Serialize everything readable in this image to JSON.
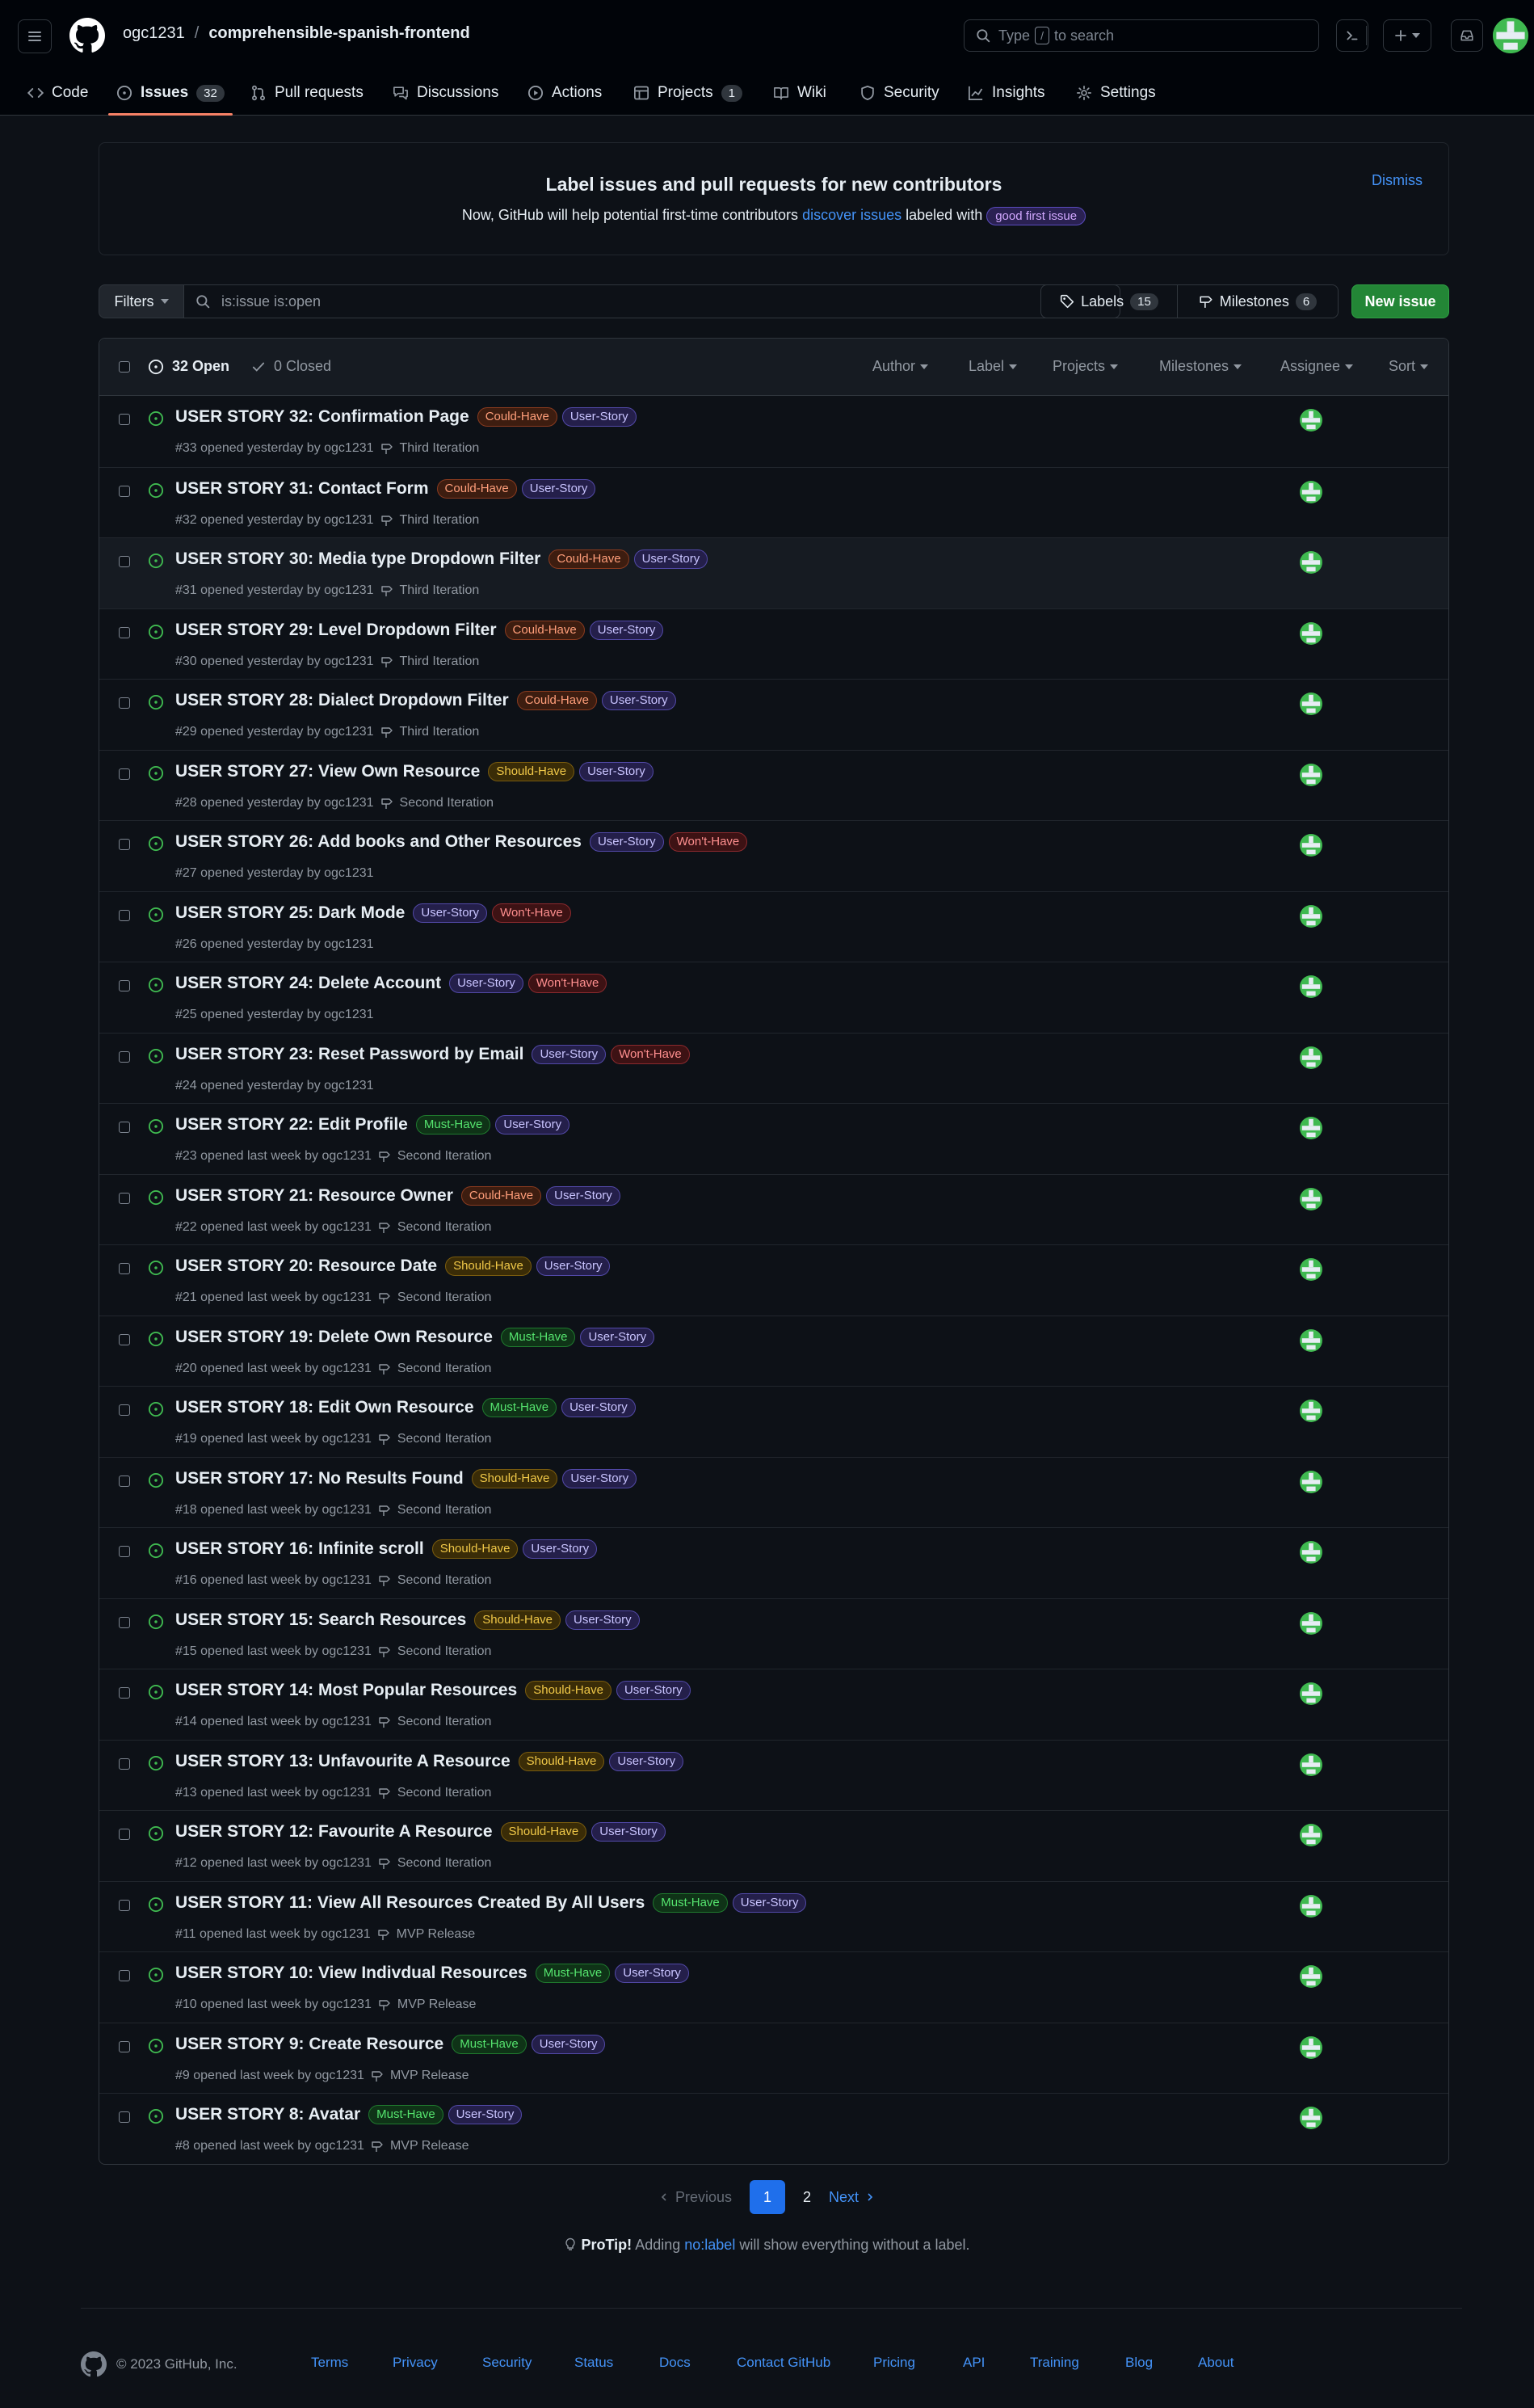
{
  "header": {
    "owner": "ogc1231",
    "separator": "/",
    "repo": "comprehensible-spanish-frontend",
    "search": {
      "prefix": "Type",
      "key": "/",
      "suffix": "to search"
    }
  },
  "nav": {
    "tabs": [
      {
        "label": "Code"
      },
      {
        "label": "Issues",
        "count": "32"
      },
      {
        "label": "Pull requests"
      },
      {
        "label": "Discussions"
      },
      {
        "label": "Actions"
      },
      {
        "label": "Projects",
        "count": "1"
      },
      {
        "label": "Wiki"
      },
      {
        "label": "Security"
      },
      {
        "label": "Insights"
      },
      {
        "label": "Settings"
      }
    ]
  },
  "banner": {
    "title": "Label issues and pull requests for new contributors",
    "text_before": "Now, GitHub will help potential first-time contributors",
    "link": "discover issues",
    "text_after": "labeled with",
    "badge": "good first issue",
    "dismiss": "Dismiss"
  },
  "toolbar": {
    "filters": "Filters",
    "query": "is:issue is:open",
    "labels": "Labels",
    "labels_count": "15",
    "milestones": "Milestones",
    "milestones_count": "6",
    "new_issue": "New issue"
  },
  "list_header": {
    "open": "32 Open",
    "closed": "0 Closed",
    "filters": [
      "Author",
      "Label",
      "Projects",
      "Milestones",
      "Assignee",
      "Sort"
    ]
  },
  "issues": [
    {
      "title": "USER STORY 32: Confirmation Page",
      "labels": [
        "Could-Have",
        "User-Story"
      ],
      "meta": "#33 opened yesterday by ogc1231",
      "milestone": "Third Iteration"
    },
    {
      "title": "USER STORY 31: Contact Form",
      "labels": [
        "Could-Have",
        "User-Story"
      ],
      "meta": "#32 opened yesterday by ogc1231",
      "milestone": "Third Iteration"
    },
    {
      "title": "USER STORY 30: Media type Dropdown Filter",
      "labels": [
        "Could-Have",
        "User-Story"
      ],
      "meta": "#31 opened yesterday by ogc1231",
      "milestone": "Third Iteration"
    },
    {
      "title": "USER STORY 29: Level Dropdown Filter",
      "labels": [
        "Could-Have",
        "User-Story"
      ],
      "meta": "#30 opened yesterday by ogc1231",
      "milestone": "Third Iteration"
    },
    {
      "title": "USER STORY 28: Dialect Dropdown Filter",
      "labels": [
        "Could-Have",
        "User-Story"
      ],
      "meta": "#29 opened yesterday by ogc1231",
      "milestone": "Third Iteration"
    },
    {
      "title": "USER STORY 27: View Own Resource",
      "labels": [
        "Should-Have",
        "User-Story"
      ],
      "meta": "#28 opened yesterday by ogc1231",
      "milestone": "Second Iteration"
    },
    {
      "title": "USER STORY 26: Add books and Other Resources",
      "labels": [
        "User-Story",
        "Won't-Have"
      ],
      "meta": "#27 opened yesterday by ogc1231",
      "milestone": ""
    },
    {
      "title": "USER STORY 25: Dark Mode",
      "labels": [
        "User-Story",
        "Won't-Have"
      ],
      "meta": "#26 opened yesterday by ogc1231",
      "milestone": ""
    },
    {
      "title": "USER STORY 24: Delete Account",
      "labels": [
        "User-Story",
        "Won't-Have"
      ],
      "meta": "#25 opened yesterday by ogc1231",
      "milestone": ""
    },
    {
      "title": "USER STORY 23: Reset Password by Email",
      "labels": [
        "User-Story",
        "Won't-Have"
      ],
      "meta": "#24 opened yesterday by ogc1231",
      "milestone": ""
    },
    {
      "title": "USER STORY 22: Edit Profile",
      "labels": [
        "Must-Have",
        "User-Story"
      ],
      "meta": "#23 opened last week by ogc1231",
      "milestone": "Second Iteration"
    },
    {
      "title": "USER STORY 21: Resource Owner",
      "labels": [
        "Could-Have",
        "User-Story"
      ],
      "meta": "#22 opened last week by ogc1231",
      "milestone": "Second Iteration"
    },
    {
      "title": "USER STORY 20: Resource Date",
      "labels": [
        "Should-Have",
        "User-Story"
      ],
      "meta": "#21 opened last week by ogc1231",
      "milestone": "Second Iteration"
    },
    {
      "title": "USER STORY 19: Delete Own Resource",
      "labels": [
        "Must-Have",
        "User-Story"
      ],
      "meta": "#20 opened last week by ogc1231",
      "milestone": "Second Iteration"
    },
    {
      "title": "USER STORY 18: Edit Own Resource",
      "labels": [
        "Must-Have",
        "User-Story"
      ],
      "meta": "#19 opened last week by ogc1231",
      "milestone": "Second Iteration"
    },
    {
      "title": "USER STORY 17: No Results Found",
      "labels": [
        "Should-Have",
        "User-Story"
      ],
      "meta": "#18 opened last week by ogc1231",
      "milestone": "Second Iteration"
    },
    {
      "title": "USER STORY 16: Infinite scroll",
      "labels": [
        "Should-Have",
        "User-Story"
      ],
      "meta": "#16 opened last week by ogc1231",
      "milestone": "Second Iteration"
    },
    {
      "title": "USER STORY 15: Search Resources",
      "labels": [
        "Should-Have",
        "User-Story"
      ],
      "meta": "#15 opened last week by ogc1231",
      "milestone": "Second Iteration"
    },
    {
      "title": "USER STORY 14: Most Popular Resources",
      "labels": [
        "Should-Have",
        "User-Story"
      ],
      "meta": "#14 opened last week by ogc1231",
      "milestone": "Second Iteration"
    },
    {
      "title": "USER STORY 13: Unfavourite A Resource",
      "labels": [
        "Should-Have",
        "User-Story"
      ],
      "meta": "#13 opened last week by ogc1231",
      "milestone": "Second Iteration"
    },
    {
      "title": "USER STORY 12: Favourite A Resource",
      "labels": [
        "Should-Have",
        "User-Story"
      ],
      "meta": "#12 opened last week by ogc1231",
      "milestone": "Second Iteration"
    },
    {
      "title": "USER STORY 11: View All Resources Created By All Users",
      "labels": [
        "Must-Have",
        "User-Story"
      ],
      "meta": "#11 opened last week by ogc1231",
      "milestone": "MVP Release"
    },
    {
      "title": "USER STORY 10: View Indivdual Resources",
      "labels": [
        "Must-Have",
        "User-Story"
      ],
      "meta": "#10 opened last week by ogc1231",
      "milestone": "MVP Release"
    },
    {
      "title": "USER STORY 9: Create Resource",
      "labels": [
        "Must-Have",
        "User-Story"
      ],
      "meta": "#9 opened last week by ogc1231",
      "milestone": "MVP Release"
    },
    {
      "title": "USER STORY 8: Avatar",
      "labels": [
        "Must-Have",
        "User-Story"
      ],
      "meta": "#8 opened last week by ogc1231",
      "milestone": "MVP Release"
    }
  ],
  "pagination": {
    "previous": "Previous",
    "current": "1",
    "next_page": "2",
    "next": "Next"
  },
  "protip": {
    "lead": "ProTip!",
    "before": "Adding",
    "link": "no:label",
    "after": "will show everything without a label."
  },
  "footer": {
    "copyright": "© 2023 GitHub, Inc.",
    "links": [
      "Terms",
      "Privacy",
      "Security",
      "Status",
      "Docs",
      "Contact GitHub",
      "Pricing",
      "API",
      "Training",
      "Blog",
      "About"
    ]
  },
  "colors": {
    "bg": "#0d1117",
    "accent": "#4493f8",
    "open": "#3fb950",
    "new_issue": "#238636",
    "tab_underline": "#f78166"
  }
}
